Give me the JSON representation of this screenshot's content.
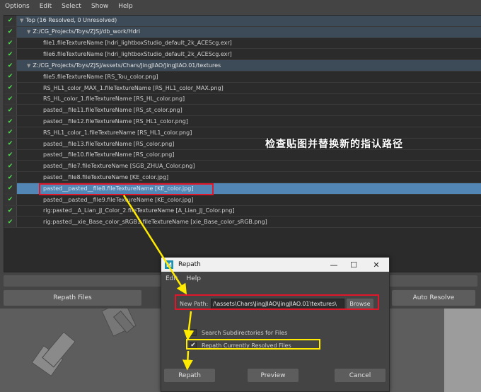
{
  "menubar": {
    "items": [
      "Options",
      "Edit",
      "Select",
      "Show",
      "Help"
    ]
  },
  "tree": {
    "rows": [
      {
        "label": "Top (16 Resolved, 0 Unresolved)",
        "type": "group",
        "level": 0
      },
      {
        "label": "Z:/CG_Projects/Toys/ZJSJ/db_work/Hdri",
        "type": "group",
        "level": 1
      },
      {
        "label": "file1.fileTextureName [hdri_lightboxStudio_default_2k_ACEScg.exr]",
        "type": "item"
      },
      {
        "label": "file6.fileTextureName [hdri_lightboxStudio_default_2k_ACEScg.exr]",
        "type": "item"
      },
      {
        "label": "Z:/CG_Projects/Toys/ZJSJ/assets/Chars/JingJIAO/JingJIAO.01/textures",
        "type": "group",
        "level": 1
      },
      {
        "label": "file5.fileTextureName [RS_Tou_color.png]",
        "type": "item"
      },
      {
        "label": "RS_HL1_color_MAX_1.fileTextureName [RS_HL1_color_MAX.png]",
        "type": "item"
      },
      {
        "label": "RS_HL_color_1.fileTextureName [RS_HL_color.png]",
        "type": "item"
      },
      {
        "label": "pasted__file11.fileTextureName [RS_st_color.png]",
        "type": "item"
      },
      {
        "label": "pasted__file12.fileTextureName [RS_HL1_color.png]",
        "type": "item"
      },
      {
        "label": "RS_HL1_color_1.fileTextureName [RS_HL1_color.png]",
        "type": "item"
      },
      {
        "label": "pasted__file13.fileTextureName [RS_color.png]",
        "type": "item"
      },
      {
        "label": "pasted__file10.fileTextureName [RS_color.png]",
        "type": "item"
      },
      {
        "label": "pasted__file7.fileTextureName [SGB_ZHUA_Color.png]",
        "type": "item"
      },
      {
        "label": "pasted__file8.fileTextureName [KE_color.jpg]",
        "type": "item"
      },
      {
        "label": "pasted__pasted__file8.fileTextureName [KE_color.jpg]",
        "type": "item",
        "selected": true
      },
      {
        "label": "pasted__pasted__file9.fileTextureName [KE_color.jpg]",
        "type": "item"
      },
      {
        "label": "rig:pasted__A_Lian_JJ_Color_2.fileTextureName [A_Lian_JJ_Color.png]",
        "type": "item"
      },
      {
        "label": "rig:pasted__xie_Base_color_sRGB1.fileTextureName [xie_Base_color_sRGB.png]",
        "type": "item"
      }
    ]
  },
  "annotation": "检查贴图并替换新的指认路径",
  "buttons": {
    "repath_files": "Repath Files",
    "auto_resolve": "Auto Resolve"
  },
  "dialog": {
    "title": "Repath",
    "menu": [
      "Edit",
      "Help"
    ],
    "new_path_label": "New Path:",
    "new_path_value": "/\\assets\\Chars\\JingJIAO\\JingJIAO.01\\textures\\",
    "browse_label": "Browse",
    "search_subdirs_label": "Search Subdirectories for Files",
    "search_subdirs_checked": false,
    "repath_resolved_label": "Repath Currently Resolved Files",
    "repath_resolved_checked": true,
    "repath_label": "Repath",
    "preview_label": "Preview",
    "cancel_label": "Cancel"
  },
  "colors": {
    "highlight_red": "#e0162b",
    "highlight_yellow": "#ffea00",
    "selection_blue": "#5286b5",
    "check_green": "#4fe04f"
  }
}
